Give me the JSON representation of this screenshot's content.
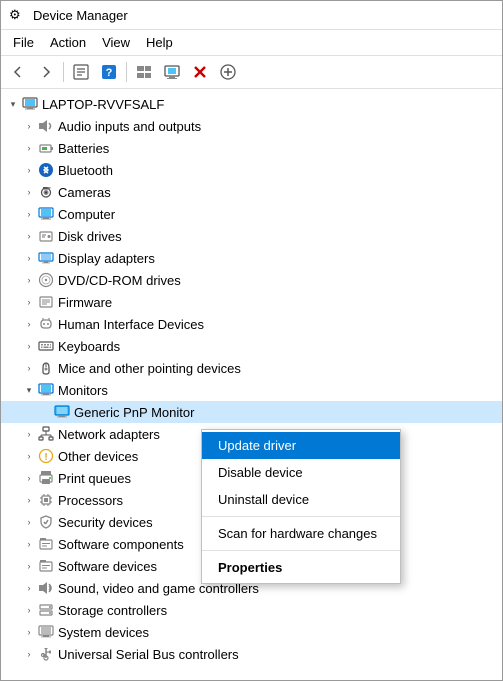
{
  "window": {
    "title": "Device Manager",
    "icon": "⚙"
  },
  "menu": {
    "items": [
      {
        "id": "file",
        "label": "File"
      },
      {
        "id": "action",
        "label": "Action"
      },
      {
        "id": "view",
        "label": "View"
      },
      {
        "id": "help",
        "label": "Help"
      }
    ]
  },
  "toolbar": {
    "buttons": [
      {
        "id": "back",
        "icon": "←",
        "label": "Back"
      },
      {
        "id": "forward",
        "icon": "→",
        "label": "Forward"
      },
      {
        "id": "properties",
        "icon": "📋",
        "label": "Properties"
      },
      {
        "id": "help-btn",
        "icon": "❓",
        "label": "Help"
      },
      {
        "id": "view-icon",
        "icon": "▤",
        "label": "View"
      },
      {
        "id": "scan",
        "icon": "🖥",
        "label": "Scan"
      },
      {
        "id": "remove",
        "icon": "✕",
        "label": "Remove"
      },
      {
        "id": "update",
        "icon": "⊕",
        "label": "Update"
      }
    ]
  },
  "tree": {
    "root": {
      "label": "LAPTOP-RVVFSALF",
      "expanded": true
    },
    "items": [
      {
        "id": "audio",
        "label": "Audio inputs and outputs",
        "icon": "🔊",
        "indent": 1,
        "expanded": false,
        "arrow": "closed"
      },
      {
        "id": "batteries",
        "label": "Batteries",
        "icon": "🔋",
        "indent": 1,
        "expanded": false,
        "arrow": "closed"
      },
      {
        "id": "bluetooth",
        "label": "Bluetooth",
        "icon": "◉",
        "indent": 1,
        "expanded": false,
        "arrow": "closed",
        "iconColor": "#1565C0"
      },
      {
        "id": "cameras",
        "label": "Cameras",
        "icon": "📷",
        "indent": 1,
        "expanded": false,
        "arrow": "closed"
      },
      {
        "id": "computer",
        "label": "Computer",
        "icon": "🖥",
        "indent": 1,
        "expanded": false,
        "arrow": "closed"
      },
      {
        "id": "disk",
        "label": "Disk drives",
        "icon": "💾",
        "indent": 1,
        "expanded": false,
        "arrow": "closed"
      },
      {
        "id": "display",
        "label": "Display adapters",
        "icon": "📺",
        "indent": 1,
        "expanded": false,
        "arrow": "closed"
      },
      {
        "id": "dvd",
        "label": "DVD/CD-ROM drives",
        "icon": "💿",
        "indent": 1,
        "expanded": false,
        "arrow": "closed"
      },
      {
        "id": "firmware",
        "label": "Firmware",
        "icon": "📟",
        "indent": 1,
        "expanded": false,
        "arrow": "closed"
      },
      {
        "id": "hid",
        "label": "Human Interface Devices",
        "icon": "🎮",
        "indent": 1,
        "expanded": false,
        "arrow": "closed"
      },
      {
        "id": "keyboards",
        "label": "Keyboards",
        "icon": "⌨",
        "indent": 1,
        "expanded": false,
        "arrow": "closed"
      },
      {
        "id": "mice",
        "label": "Mice and other pointing devices",
        "icon": "🖱",
        "indent": 1,
        "expanded": false,
        "arrow": "closed"
      },
      {
        "id": "monitors",
        "label": "Monitors",
        "icon": "🖥",
        "indent": 1,
        "expanded": true,
        "arrow": "open",
        "selected": false
      },
      {
        "id": "generic-pnp",
        "label": "Generic PnP Monitor",
        "icon": "🖥",
        "indent": 2,
        "expanded": false,
        "arrow": "none",
        "selected": true
      },
      {
        "id": "network",
        "label": "Network adapters",
        "icon": "🌐",
        "indent": 1,
        "expanded": false,
        "arrow": "closed"
      },
      {
        "id": "other",
        "label": "Other devices",
        "icon": "❓",
        "indent": 1,
        "expanded": false,
        "arrow": "closed"
      },
      {
        "id": "print",
        "label": "Print queues",
        "icon": "🖨",
        "indent": 1,
        "expanded": false,
        "arrow": "closed"
      },
      {
        "id": "processors",
        "label": "Processors",
        "icon": "📦",
        "indent": 1,
        "expanded": false,
        "arrow": "closed"
      },
      {
        "id": "security",
        "label": "Security devices",
        "icon": "🔒",
        "indent": 1,
        "expanded": false,
        "arrow": "closed"
      },
      {
        "id": "software-comp",
        "label": "Software components",
        "icon": "📦",
        "indent": 1,
        "expanded": false,
        "arrow": "closed"
      },
      {
        "id": "software-dev",
        "label": "Software devices",
        "icon": "📦",
        "indent": 1,
        "expanded": false,
        "arrow": "closed"
      },
      {
        "id": "sound",
        "label": "Sound, video and game controllers",
        "icon": "🔊",
        "indent": 1,
        "expanded": false,
        "arrow": "closed"
      },
      {
        "id": "storage",
        "label": "Storage controllers",
        "icon": "💾",
        "indent": 1,
        "expanded": false,
        "arrow": "closed"
      },
      {
        "id": "system",
        "label": "System devices",
        "icon": "🖥",
        "indent": 1,
        "expanded": false,
        "arrow": "closed"
      },
      {
        "id": "usb",
        "label": "Universal Serial Bus controllers",
        "icon": "🔌",
        "indent": 1,
        "expanded": false,
        "arrow": "closed"
      }
    ]
  },
  "context_menu": {
    "items": [
      {
        "id": "update-driver",
        "label": "Update driver",
        "highlighted": true,
        "bold": false
      },
      {
        "id": "disable-device",
        "label": "Disable device",
        "highlighted": false,
        "bold": false
      },
      {
        "id": "uninstall-device",
        "label": "Uninstall device",
        "highlighted": false,
        "bold": false
      },
      {
        "id": "scan-changes",
        "label": "Scan for hardware changes",
        "highlighted": false,
        "bold": false
      },
      {
        "id": "properties",
        "label": "Properties",
        "highlighted": false,
        "bold": true
      }
    ]
  }
}
